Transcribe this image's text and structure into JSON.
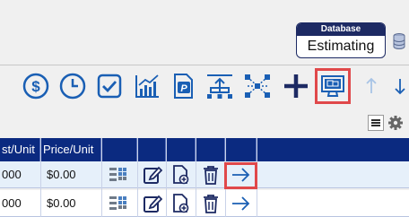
{
  "database": {
    "header_label": "Database",
    "name": "Estimating"
  },
  "toolbar": {
    "icons": [
      "dollar-circle-icon",
      "clock-icon",
      "checkbox-icon",
      "chart-growth-icon",
      "pdf-document-icon",
      "upload-icon",
      "network-nodes-icon",
      "plus-icon",
      "monitor-icon",
      "arrow-up-icon",
      "arrow-down-icon"
    ],
    "highlighted_icon": "monitor-icon",
    "secondary_icons": [
      "list-menu-icon",
      "gear-icon"
    ]
  },
  "grid": {
    "columns": [
      "st/Unit",
      "Price/Unit"
    ],
    "rows": [
      {
        "cost_unit": "000",
        "price_unit": "$0.00"
      },
      {
        "cost_unit": "000",
        "price_unit": "$0.00"
      }
    ],
    "row_action_icons": [
      "grid-list-icon",
      "edit-icon",
      "new-document-icon",
      "trash-icon",
      "arrow-right-icon"
    ],
    "highlighted_row_action": "arrow-right-icon"
  },
  "colors": {
    "accent": "#1a5fb4",
    "header_bg": "#0b2a80",
    "highlight": "#e0484a",
    "db_header": "#1d2a63",
    "selected_row": "#e6f0fa"
  }
}
